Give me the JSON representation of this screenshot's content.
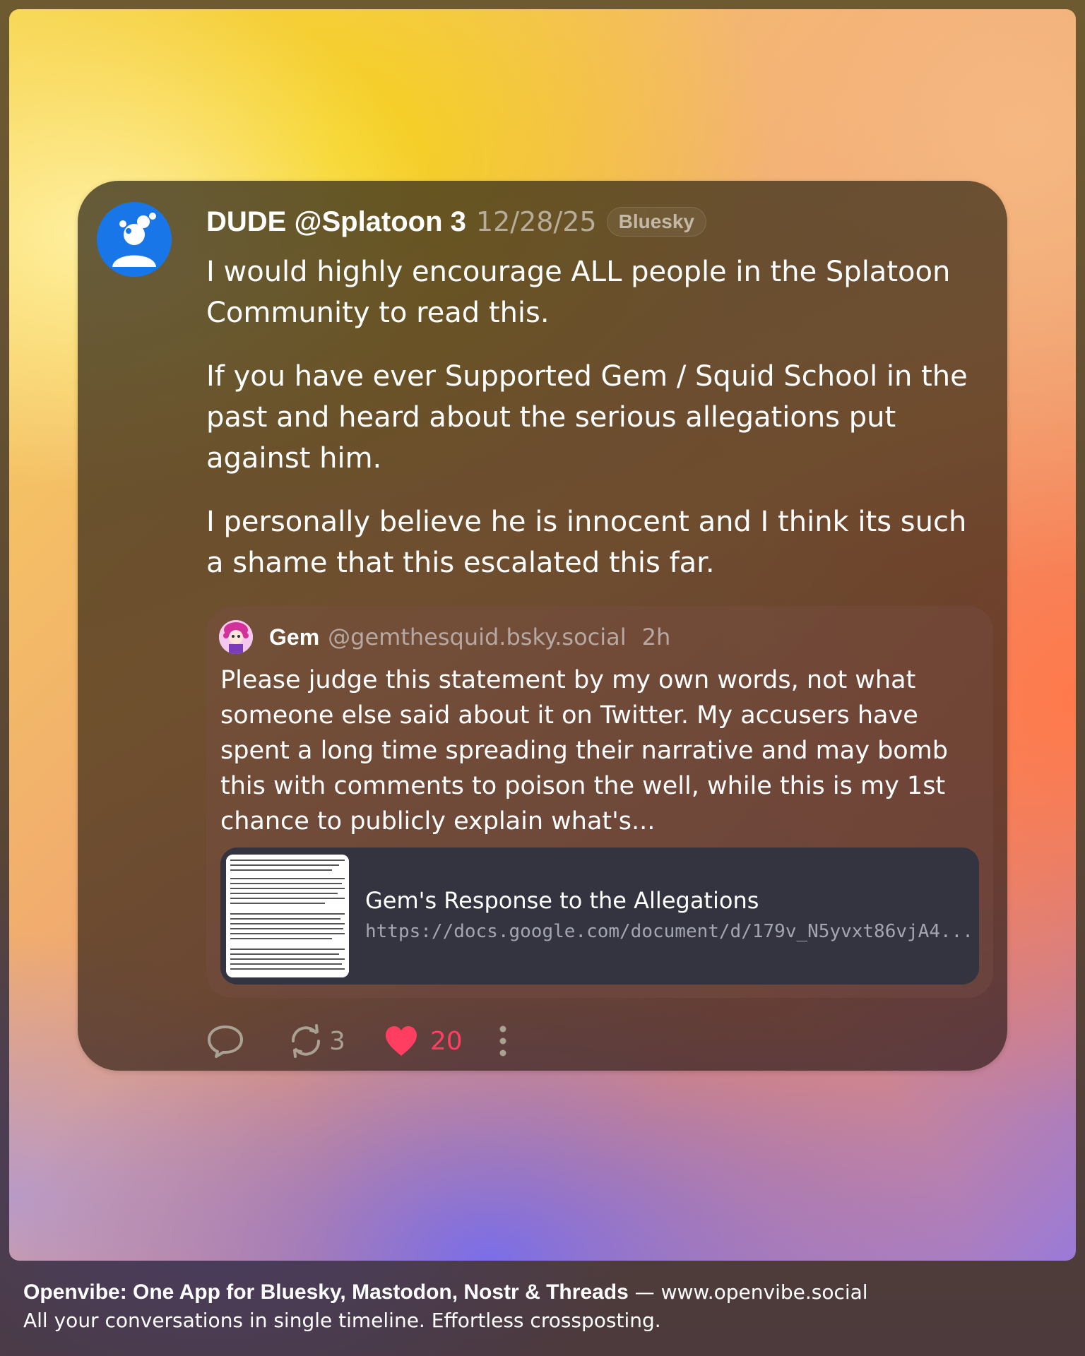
{
  "post": {
    "display_name": "DUDE @Splatoon 3",
    "date": "12/28/25",
    "network": "Bluesky",
    "paragraphs": [
      "I would highly encourage ALL people in the Splatoon Community to read this.",
      "If you have ever Supported Gem / Squid School in the past and heard about the serious allegations put against him.",
      "I personally believe he is innocent and I think its such a shame that this escalated this far."
    ],
    "avatar_icon": "bluesky-default-avatar-icon"
  },
  "quote": {
    "name": "Gem",
    "handle": "@gemthesquid.bsky.social",
    "time": "2h",
    "text": "Please judge this statement by my own words, not what someone else said about it on Twitter. My accusers have spent a long time spreading their narrative and may bomb this with comments to poison the well, while this is my 1st chance to publicly explain what's...",
    "link": {
      "title": "Gem's Response to the Allegations",
      "url": "https://docs.google.com/document/d/179v_N5yvxt86vjA4..."
    }
  },
  "actions": {
    "reply_icon": "speech-bubble-icon",
    "repost_icon": "repost-arrows-icon",
    "repost_count": "3",
    "like_icon": "heart-icon",
    "like_count": "20",
    "more_icon": "vertical-dots-icon"
  },
  "footer": {
    "brand": "Openvibe: One App for Bluesky, Mastodon, Nostr & Threads",
    "separator": " — ",
    "site": "www.openvibe.social",
    "tagline": "All your conversations in single timeline. Effortless crossposting."
  },
  "colors": {
    "like": "#ff3e62",
    "avatar_blue": "#1976e8",
    "link_card_bg": "#33343f"
  }
}
